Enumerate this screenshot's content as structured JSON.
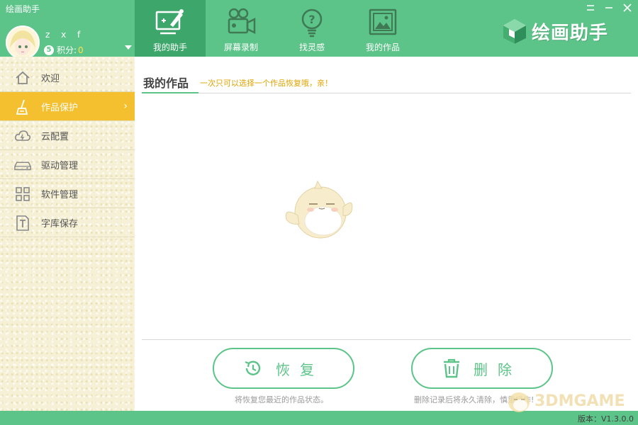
{
  "window": {
    "app_title": "绘画助手",
    "minimize_icon": "minimize-icon",
    "close_icon": "close-icon"
  },
  "user": {
    "name": "z x f",
    "level": "5",
    "points_label": "积分:",
    "points_value": "0"
  },
  "nav": {
    "tabs": [
      {
        "label": "我的助手",
        "icon": "assistant-monitor-icon",
        "active": true
      },
      {
        "label": "屏幕录制",
        "icon": "camera-icon",
        "active": false
      },
      {
        "label": "找灵感",
        "icon": "lightbulb-icon",
        "active": false
      },
      {
        "label": "我的作品",
        "icon": "picture-icon",
        "active": false
      }
    ]
  },
  "brand": {
    "text": "绘画助手"
  },
  "sidebar": {
    "items": [
      {
        "label": "欢迎",
        "icon": "home-icon"
      },
      {
        "label": "作品保护",
        "icon": "paint-brush-icon",
        "active": true
      },
      {
        "label": "云配置",
        "icon": "cloud-icon"
      },
      {
        "label": "驱动管理",
        "icon": "drive-icon"
      },
      {
        "label": "软件管理",
        "icon": "grid-icon"
      },
      {
        "label": "字库保存",
        "icon": "font-icon"
      }
    ]
  },
  "main": {
    "title": "我的作品",
    "hint": "一次只可以选择一个作品恢复哦，亲！",
    "restore_label": "恢复",
    "restore_note": "将恢复您最近的作品状态。",
    "delete_label": "删除",
    "delete_note": "删除记录后将永久清除，慎重操作!"
  },
  "footer": {
    "version": "版本：V1.3.0.0"
  },
  "watermark": {
    "text": "3DMGAME"
  },
  "colors": {
    "primary_green": "#5cc488",
    "active_tab": "#3da66a",
    "sidebar_active": "#f5c02f",
    "hint_orange": "#e0a300"
  }
}
